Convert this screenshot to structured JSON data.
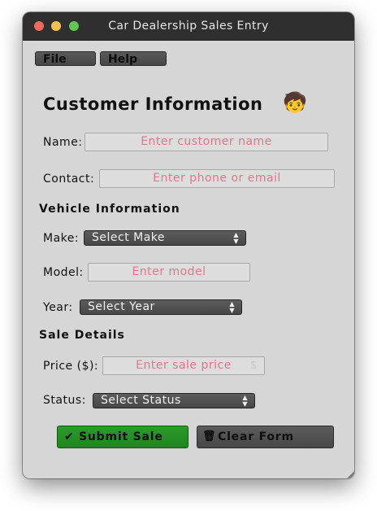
{
  "window": {
    "title": "Car Dealership Sales Entry"
  },
  "menu": {
    "file_label": "File",
    "help_label": "Help"
  },
  "customer": {
    "heading": "Customer Information",
    "avatar_emoji": "🧒",
    "name_label": "Name:",
    "name_placeholder": "Enter customer name",
    "contact_label": "Contact:",
    "contact_placeholder": "Enter phone or email"
  },
  "vehicle": {
    "heading": "Vehicle Information",
    "make_label": "Make:",
    "make_selected": "Select Make",
    "model_label": "Model:",
    "model_placeholder": "Enter model",
    "year_label": "Year:",
    "year_selected": "Select Year"
  },
  "sale": {
    "heading": "Sale Details",
    "price_label": "Price ($):",
    "price_placeholder": "Enter sale price",
    "price_suffix": "$",
    "status_label": "Status:",
    "status_selected": "Select Status"
  },
  "actions": {
    "submit_icon": "✔",
    "submit_label": "Submit Sale",
    "clear_icon": "🗑",
    "clear_label": "Clear Form"
  },
  "colors": {
    "submit_green": "#228b22",
    "placeholder_pink": "#e0778a",
    "window_bg": "#d6d6d6"
  }
}
